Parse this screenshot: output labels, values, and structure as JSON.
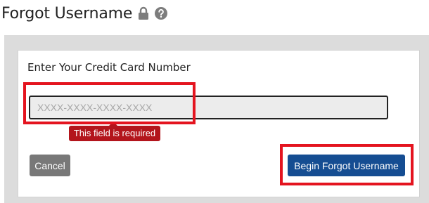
{
  "header": {
    "title": "Forgot Username",
    "icons": [
      "lock-icon",
      "help-icon"
    ]
  },
  "form": {
    "label": "Enter Your Credit Card Number",
    "input": {
      "value": "",
      "placeholder": "XXXX-XXXX-XXXX-XXXX"
    },
    "error": "This field is required"
  },
  "buttons": {
    "cancel_label": "Cancel",
    "submit_label": "Begin Forgot Username"
  },
  "colors": {
    "highlight": "#e4141f",
    "error_bg": "#b3151c",
    "primary_button": "#154d92",
    "cancel_button": "#787878",
    "panel_bg": "#dcdcdc"
  }
}
